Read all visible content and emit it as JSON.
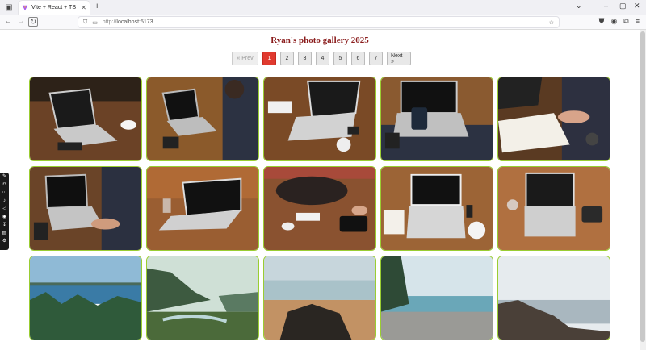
{
  "browser": {
    "tab_title": "Vite + React + TS",
    "url_host": "http://",
    "url_path": "localhost:5173"
  },
  "page": {
    "title": "Ryan's photo gallery 2025"
  },
  "pagination": {
    "prev_label": "« Prev",
    "pages": [
      "1",
      "2",
      "3",
      "4",
      "5",
      "6",
      "7"
    ],
    "active_page": "1",
    "next_label": "Next »"
  },
  "gallery": {
    "photos": [
      {
        "subject": "laptop on wooden table"
      },
      {
        "subject": "person typing on laptop"
      },
      {
        "subject": "laptop with coffee cup"
      },
      {
        "subject": "phone held over laptop"
      },
      {
        "subject": "writing in notebook next to laptop"
      },
      {
        "subject": "hands typing on laptop"
      },
      {
        "subject": "laptop on wooden desk"
      },
      {
        "subject": "desk with bag and tablet"
      },
      {
        "subject": "laptop with notebook and coffee"
      },
      {
        "subject": "laptop with phone and glass"
      },
      {
        "subject": "coastal lake with trees"
      },
      {
        "subject": "misty river valley"
      },
      {
        "subject": "beach with rocks at sunset"
      },
      {
        "subject": "pebble beach and forest"
      },
      {
        "subject": "rocky shore in fog"
      }
    ]
  },
  "colors": {
    "title": "#8a1c1c",
    "active_page": "#e03a2f",
    "photo_border": "#9acd32"
  }
}
